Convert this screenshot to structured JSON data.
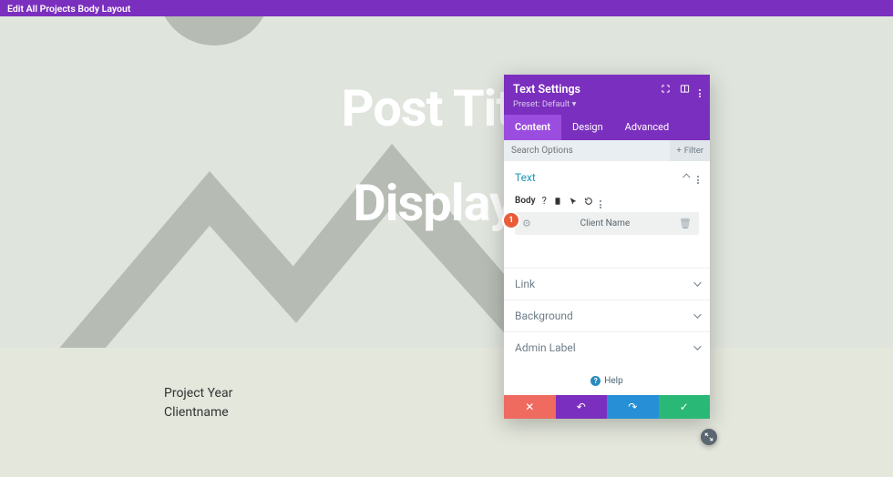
{
  "topbar": {
    "title": "Edit All Projects Body Layout"
  },
  "hero": {
    "line1": "Post Title",
    "line2": "Display I"
  },
  "body": {
    "line1": "Project Year",
    "line2": "Clientname"
  },
  "panel": {
    "title": "Text Settings",
    "preset": "Preset: Default ▾",
    "tabs": {
      "content": "Content",
      "design": "Design",
      "advanced": "Advanced"
    },
    "search": {
      "placeholder": "Search Options",
      "filter": "Filter"
    },
    "sections": {
      "text": {
        "title": "Text",
        "body_label": "Body",
        "field_value": "Client Name",
        "marker": "1"
      },
      "link": {
        "title": "Link"
      },
      "background": {
        "title": "Background"
      },
      "admin": {
        "title": "Admin Label"
      }
    },
    "help": "Help",
    "footer": {
      "cancel": "✕",
      "undo": "↶",
      "redo": "↷",
      "save": "✓"
    }
  }
}
